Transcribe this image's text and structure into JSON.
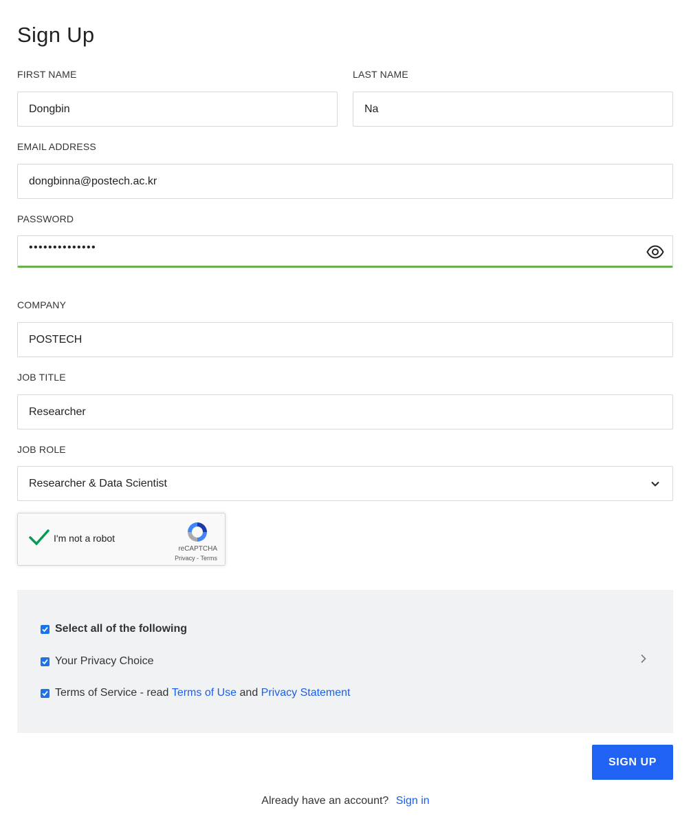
{
  "title": "Sign Up",
  "fields": {
    "first_name": {
      "label": "FIRST NAME",
      "value": "Dongbin"
    },
    "last_name": {
      "label": "LAST NAME",
      "value": "Na"
    },
    "email": {
      "label": "EMAIL ADDRESS",
      "value": "dongbinna@postech.ac.kr"
    },
    "password": {
      "label": "PASSWORD",
      "masked": "••••••••••••••"
    },
    "company": {
      "label": "COMPANY",
      "value": "POSTECH"
    },
    "job_title": {
      "label": "JOB TITLE",
      "value": "Researcher"
    },
    "job_role": {
      "label": "JOB ROLE",
      "value": "Researcher & Data Scientist"
    }
  },
  "recaptcha": {
    "label": "I'm not a robot",
    "brand": "reCAPTCHA",
    "links": "Privacy - Terms",
    "checked": true
  },
  "consent": {
    "select_all": "Select all of the following",
    "privacy_choice": "Your Privacy Choice",
    "terms_prefix": "Terms of Service - read ",
    "terms_link": "Terms of Use",
    "and": " and ",
    "privacy_link": "Privacy Statement"
  },
  "actions": {
    "signup_label": "SIGN UP",
    "have_account": "Already have an account?",
    "signin_link": "Sign in"
  },
  "colors": {
    "accent": "#1f62f4",
    "link": "#1a5fe8",
    "password_ok": "#6ab04c",
    "checkbox": "#1a73e8",
    "captcha_check": "#009e55"
  },
  "icons": [
    "eye-icon",
    "chevron-down-icon",
    "check-icon",
    "recaptcha-logo-icon",
    "chevron-right-icon"
  ]
}
